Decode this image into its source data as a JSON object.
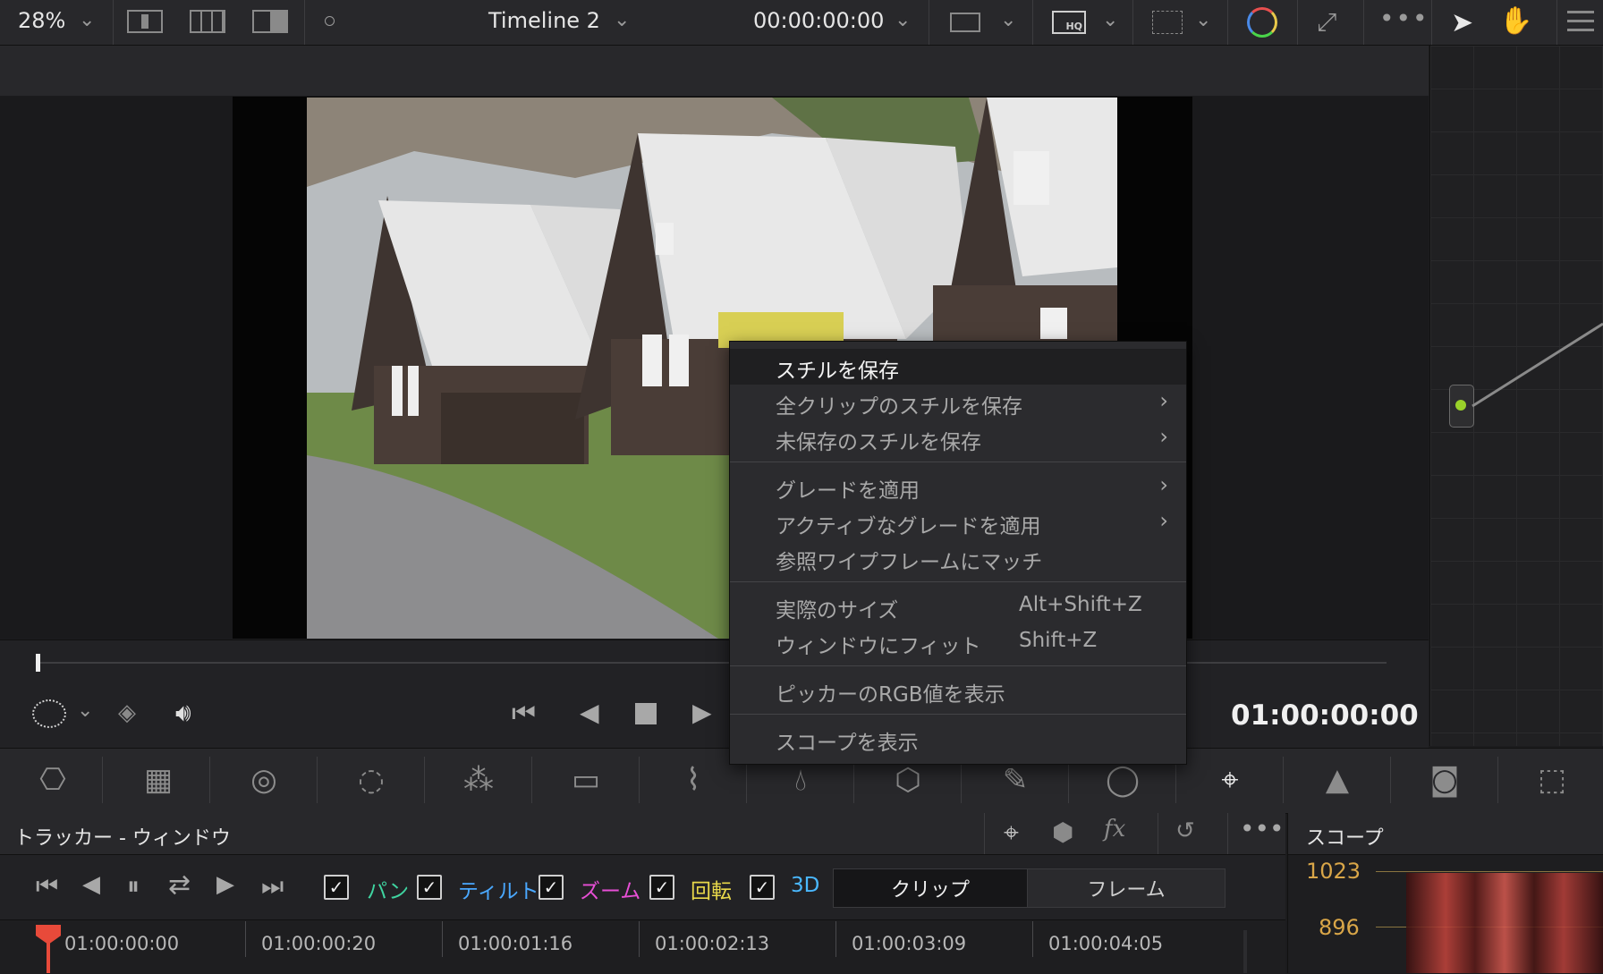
{
  "top_toolbar": {
    "zoom": "28%",
    "timeline_name": "Timeline 2",
    "timecode": "00:00:00:00"
  },
  "viewer": {
    "timecode": "01:00:00:00"
  },
  "context_menu": {
    "items": [
      {
        "label": "スチルを保存",
        "shortcut": "",
        "submenu": false
      },
      {
        "label": "全クリップのスチルを保存",
        "shortcut": "",
        "submenu": true
      },
      {
        "label": "未保存のスチルを保存",
        "shortcut": "",
        "submenu": true
      },
      {
        "label": "グレードを適用",
        "shortcut": "",
        "submenu": true
      },
      {
        "label": "アクティブなグレードを適用",
        "shortcut": "",
        "submenu": true
      },
      {
        "label": "参照ワイプフレームにマッチ",
        "shortcut": "",
        "submenu": false
      },
      {
        "label": "実際のサイズ",
        "shortcut": "Alt+Shift+Z",
        "submenu": false
      },
      {
        "label": "ウィンドウにフィット",
        "shortcut": "Shift+Z",
        "submenu": false
      },
      {
        "label": "ピッカーのRGB値を表示",
        "shortcut": "",
        "submenu": false
      },
      {
        "label": "スコープを表示",
        "shortcut": "",
        "submenu": false
      }
    ]
  },
  "tracker": {
    "title": "トラッカー - ウィンドウ",
    "options": [
      {
        "label": "パン",
        "color": "#3fd4a0"
      },
      {
        "label": "ティルト",
        "color": "#4aa8ff"
      },
      {
        "label": "ズーム",
        "color": "#e84fd6"
      },
      {
        "label": "回転",
        "color": "#e8d84a"
      },
      {
        "label": "3D",
        "color": "#4ab8ff"
      }
    ],
    "modes": [
      "クリップ",
      "フレーム"
    ],
    "timecodes": [
      "01:00:00:00",
      "01:00:00:20",
      "01:00:01:16",
      "01:00:02:13",
      "01:00:03:09",
      "01:00:04:05"
    ]
  },
  "scopes": {
    "title": "スコープ",
    "levels": [
      "1023",
      "896"
    ]
  }
}
